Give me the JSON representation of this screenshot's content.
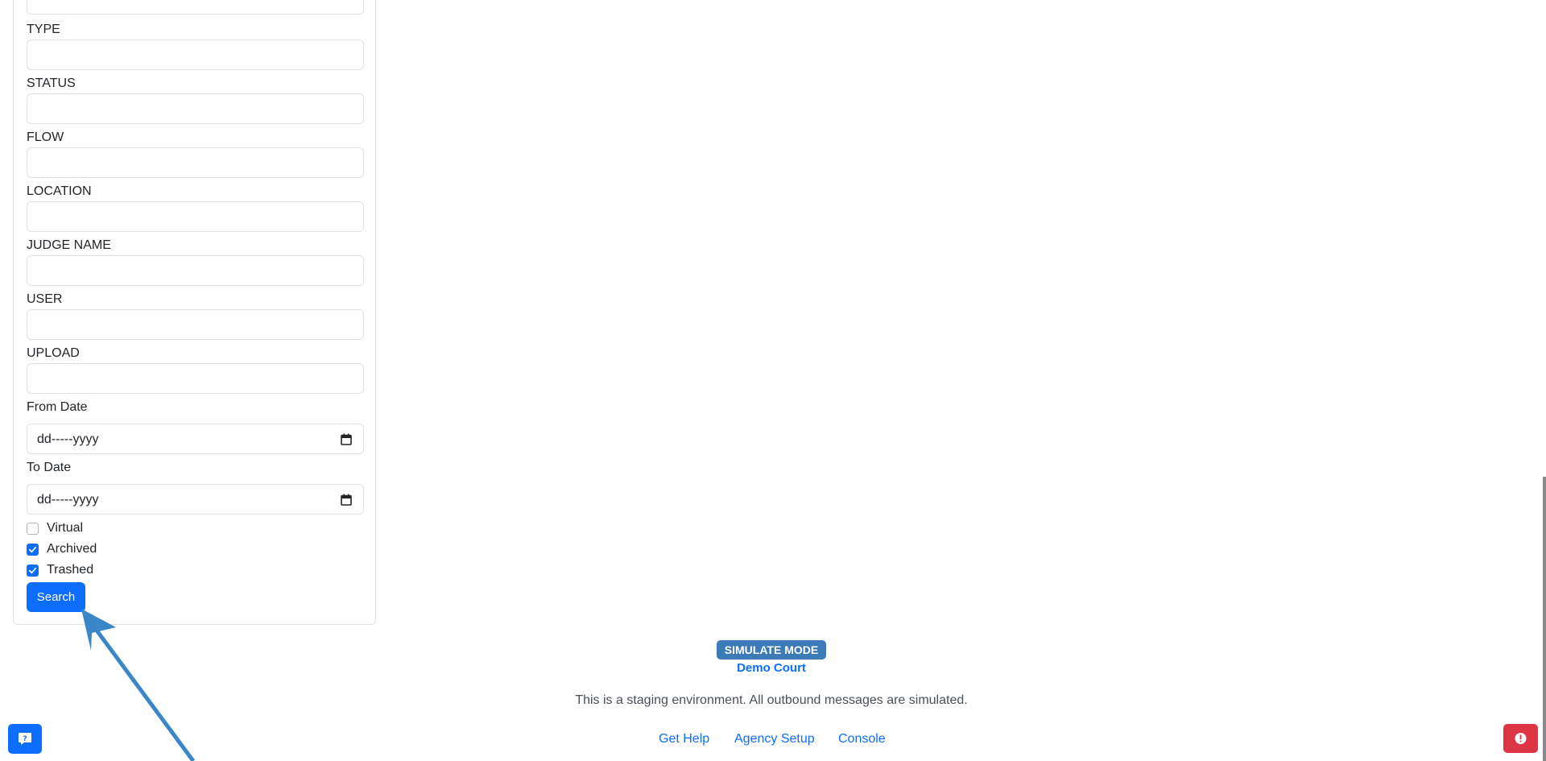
{
  "filters": {
    "fields": [
      {
        "label": "TYPE",
        "value": ""
      },
      {
        "label": "STATUS",
        "value": ""
      },
      {
        "label": "FLOW",
        "value": ""
      },
      {
        "label": "LOCATION",
        "value": ""
      },
      {
        "label": "JUDGE NAME",
        "value": ""
      },
      {
        "label": "USER",
        "value": ""
      },
      {
        "label": "UPLOAD",
        "value": ""
      }
    ],
    "from_date": {
      "label": "From Date",
      "value": "dd-----yyyy"
    },
    "to_date": {
      "label": "To Date",
      "value": "dd-----yyyy"
    },
    "checkboxes": [
      {
        "label": "Virtual",
        "checked": false
      },
      {
        "label": "Archived",
        "checked": true
      },
      {
        "label": "Trashed",
        "checked": true
      }
    ],
    "search_label": "Search"
  },
  "footer": {
    "badge": "SIMULATE MODE",
    "court_name": "Demo Court",
    "staging_note": "This is a staging environment. All outbound messages are simulated.",
    "links": [
      "Get Help",
      "Agency Setup",
      "Console"
    ]
  },
  "colors": {
    "primary": "#0d6efd",
    "badge": "#3d7ab8",
    "danger": "#dc3545",
    "annotation_arrow": "#3a86c8"
  },
  "icons": {
    "date_picker": "calendar-icon",
    "chat": "help-chat-icon",
    "alert": "alert-circle-icon"
  }
}
